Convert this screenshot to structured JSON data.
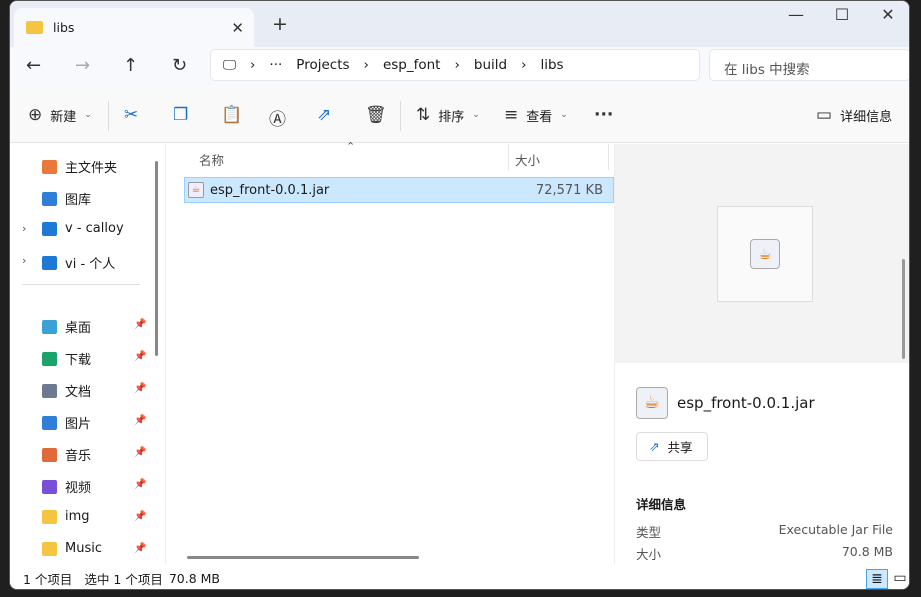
{
  "tab": {
    "title": "libs",
    "new_tab": "+",
    "close": "✕"
  },
  "window": {
    "minimize": "—",
    "maximize": "☐",
    "close": "✕"
  },
  "address": {
    "more": "···",
    "crumbs": [
      "Projects",
      "esp_font",
      "build",
      "libs"
    ]
  },
  "search": {
    "placeholder": "在 libs 中搜索"
  },
  "toolbar": {
    "new": "新建",
    "sort": "排序",
    "view": "查看",
    "more": "···",
    "details": "详细信息"
  },
  "sidebar": {
    "items": [
      {
        "label": "主文件夹",
        "icon": "home-icon",
        "color": "#e8793a"
      },
      {
        "label": "图库",
        "icon": "gallery-icon",
        "color": "#2f7fd8"
      },
      {
        "label": "v - calloy",
        "icon": "cloud-icon",
        "color": "#1d78d6",
        "expandable": true
      },
      {
        "label": "vi - 个人",
        "icon": "cloud-icon",
        "color": "#1d78d6",
        "expandable": true
      },
      {
        "label": "桌面",
        "icon": "desktop-icon",
        "color": "#3aa0d8",
        "pinned": true
      },
      {
        "label": "下载",
        "icon": "download-icon",
        "color": "#1aa36a",
        "pinned": true
      },
      {
        "label": "文档",
        "icon": "document-icon",
        "color": "#6b7a90",
        "pinned": true
      },
      {
        "label": "图片",
        "icon": "pictures-icon",
        "color": "#2f7fd8",
        "pinned": true
      },
      {
        "label": "音乐",
        "icon": "music-icon",
        "color": "#e06a3a",
        "pinned": true
      },
      {
        "label": "视频",
        "icon": "video-icon",
        "color": "#7a4fd8",
        "pinned": true
      },
      {
        "label": "img",
        "icon": "folder-icon",
        "color": "#f5c542",
        "pinned": true
      },
      {
        "label": "Music",
        "icon": "folder-icon",
        "color": "#f5c542",
        "pinned": true
      }
    ]
  },
  "list": {
    "col_name": "名称",
    "col_size": "大小",
    "files": [
      {
        "name": "esp_front-0.0.1.jar",
        "size": "72,571 KB"
      }
    ]
  },
  "details": {
    "filename": "esp_front-0.0.1.jar",
    "share": "共享",
    "section": "详细信息",
    "type_label": "类型",
    "type_value": "Executable Jar File",
    "size_label": "大小",
    "size_value": "70.8 MB"
  },
  "status": {
    "count": "1 个项目",
    "selected": "选中 1 个项目",
    "size": "70.8 MB"
  }
}
